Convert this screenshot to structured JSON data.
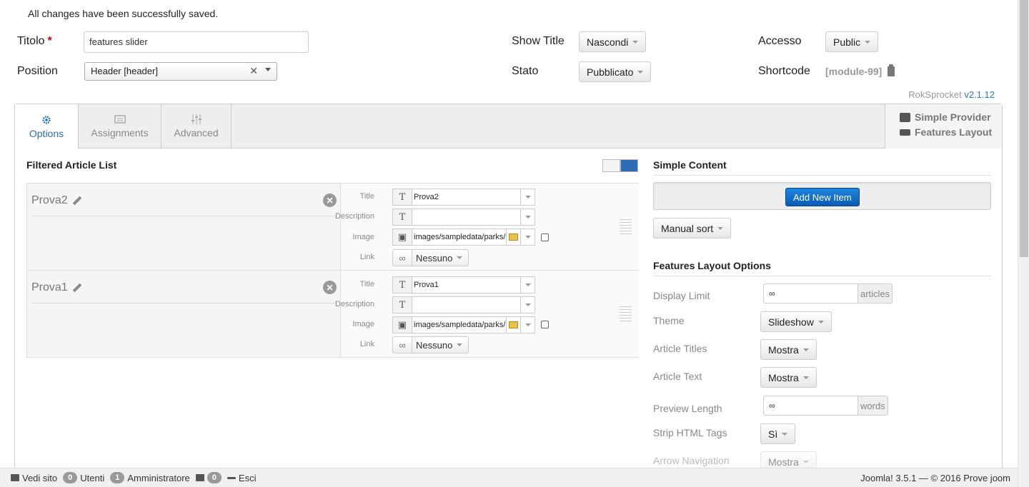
{
  "message": "All changes have been successfully saved.",
  "form": {
    "title_label": "Titolo",
    "title_required": "*",
    "title_value": "features slider",
    "position_label": "Position",
    "position_value": "Header [header]",
    "position_clear": "✕",
    "show_title_label": "Show Title",
    "show_title_value": "Nascondi",
    "stato_label": "Stato",
    "stato_value": "Pubblicato",
    "accesso_label": "Accesso",
    "accesso_value": "Public",
    "shortcode_label": "Shortcode",
    "shortcode_value": "[module-99]"
  },
  "version": {
    "name": "RokSprocket",
    "number": "v2.1.12"
  },
  "tabs": [
    {
      "label": "Options",
      "icon": "gear-icon",
      "active": true
    },
    {
      "label": "Assignments",
      "icon": "assignments-icon",
      "active": false
    },
    {
      "label": "Advanced",
      "icon": "sliders-icon",
      "active": false
    }
  ],
  "provider": {
    "line1": "Simple Provider",
    "line2": "Features Layout"
  },
  "article_list": {
    "title": "Filtered Article List",
    "field_labels": {
      "title": "Title",
      "description": "Description",
      "image": "Image",
      "link": "Link"
    },
    "items": [
      {
        "name": "Prova2",
        "title": "Prova2",
        "description": "",
        "image": "images/sampledata/parks/la",
        "link": "Nessuno"
      },
      {
        "name": "Prova1",
        "title": "Prova1",
        "description": "",
        "image": "images/sampledata/parks/la",
        "link": "Nessuno"
      }
    ]
  },
  "simple_content": {
    "title": "Simple Content",
    "add_button": "Add New Item",
    "sort_button": "Manual sort"
  },
  "layout_options": {
    "title": "Features Layout Options",
    "display_limit_label": "Display Limit",
    "display_limit_value": "∞",
    "display_limit_addon": "articles",
    "theme_label": "Theme",
    "theme_value": "Slideshow",
    "article_titles_label": "Article Titles",
    "article_titles_value": "Mostra",
    "article_text_label": "Article Text",
    "article_text_value": "Mostra",
    "preview_length_label": "Preview Length",
    "preview_length_value": "∞",
    "preview_length_addon": "words",
    "strip_html_label": "Strip HTML Tags",
    "strip_html_value": "Sì",
    "arrow_nav_label": "Arrow Navigation",
    "arrow_nav_value": "Mostra"
  },
  "footer": {
    "view_site": "Vedi sito",
    "users_count": "0",
    "users_label": "Utenti",
    "admins_count": "1",
    "admins_label": "Amministratore",
    "messages_count": "0",
    "logout": "Esci",
    "copyright": "Joomla! 3.5.1 — © 2016 Prove joom"
  }
}
